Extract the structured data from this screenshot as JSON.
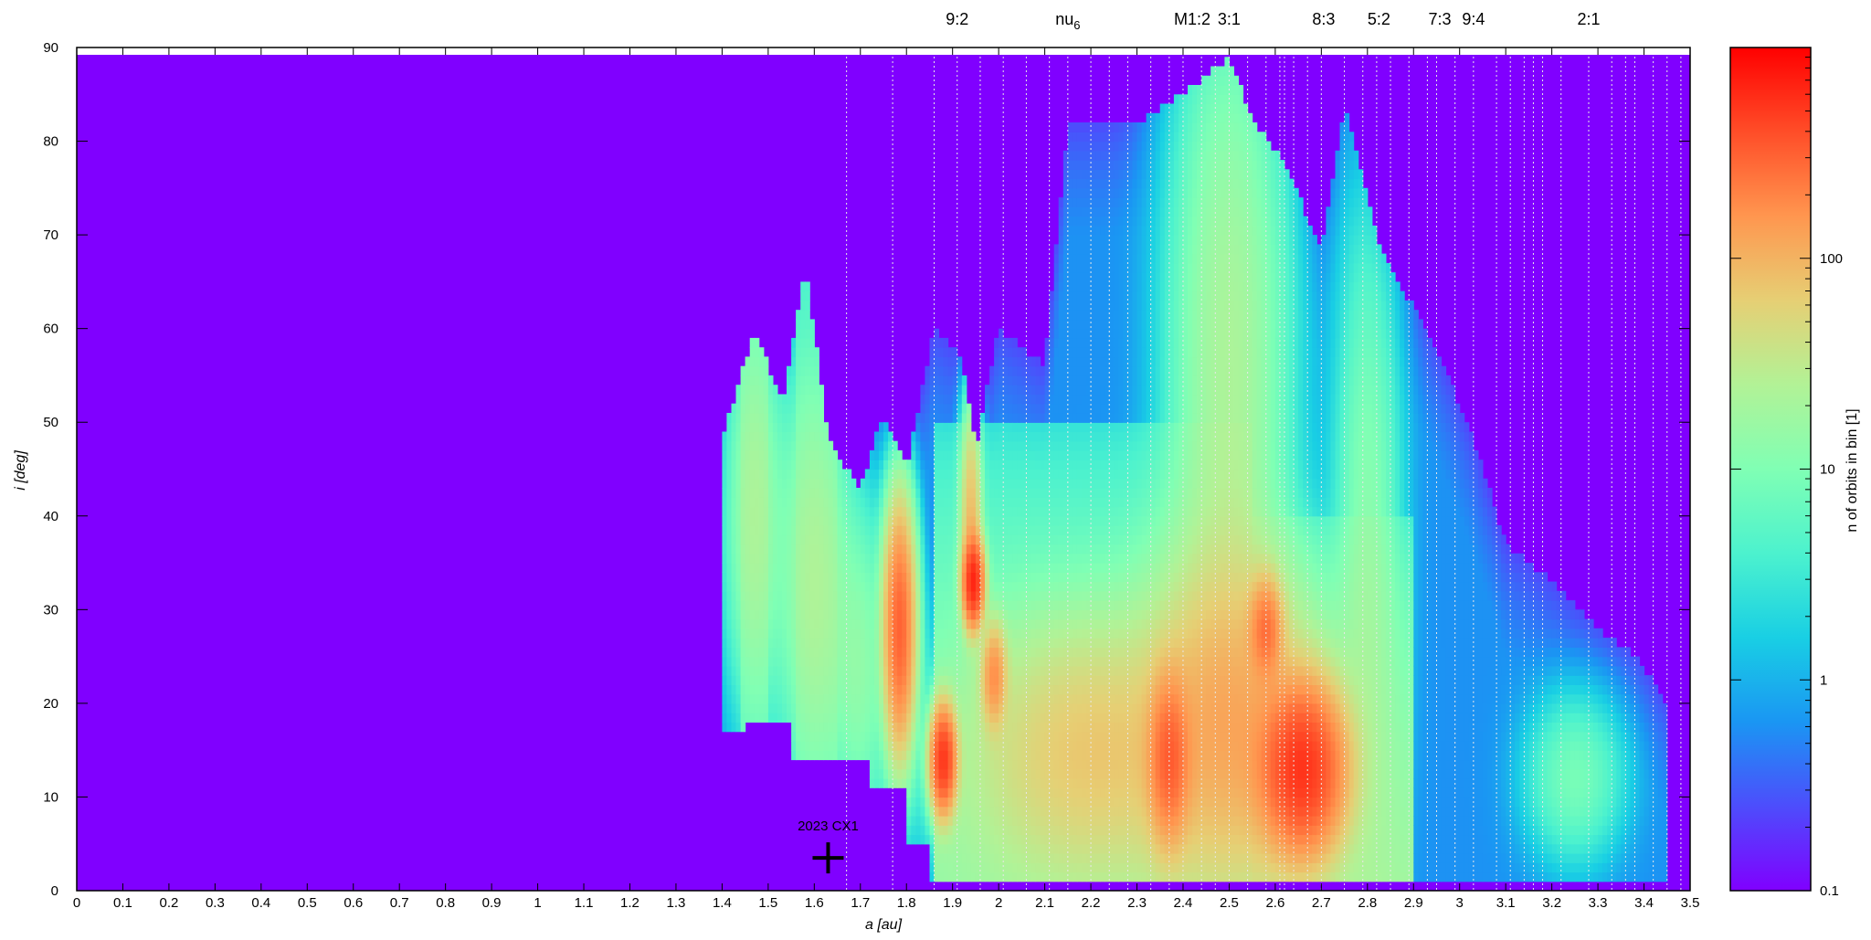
{
  "chart_data": {
    "type": "heatmap",
    "xlabel": "a [au]",
    "ylabel": "i [deg]",
    "xlim": [
      0,
      3.5
    ],
    "ylim": [
      0,
      90
    ],
    "xticks": [
      "0",
      "0.1",
      "0.2",
      "0.3",
      "0.4",
      "0.5",
      "0.6",
      "0.7",
      "0.8",
      "0.9",
      "1",
      "1.1",
      "1.2",
      "1.3",
      "1.4",
      "1.5",
      "1.6",
      "1.7",
      "1.8",
      "1.9",
      "2",
      "2.1",
      "2.2",
      "2.3",
      "2.4",
      "2.5",
      "2.6",
      "2.7",
      "2.8",
      "2.9",
      "3",
      "3.1",
      "3.2",
      "3.3",
      "3.4",
      "3.5"
    ],
    "yticks": [
      "0",
      "10",
      "20",
      "30",
      "40",
      "50",
      "60",
      "70",
      "80",
      "90"
    ],
    "colorbar": {
      "label": "n of orbits in bin [1]",
      "scale": "log",
      "range": [
        0.1,
        1000
      ],
      "ticks": [
        "0.1",
        "1",
        "10",
        "100"
      ]
    },
    "background_color": "#8000ff",
    "resonances": [
      {
        "label": "9:2",
        "a": 1.91
      },
      {
        "label": "nu6",
        "a": 2.15
      },
      {
        "label": "M1:2",
        "a": 2.42
      },
      {
        "label": "3:1",
        "a": 2.5
      },
      {
        "label": "8:3",
        "a": 2.705
      },
      {
        "label": "5:2",
        "a": 2.825
      },
      {
        "label": "7:3",
        "a": 2.957
      },
      {
        "label": "9:4",
        "a": 3.03
      },
      {
        "label": "2:1",
        "a": 3.28
      }
    ],
    "resonance_lines_a": [
      1.67,
      1.77,
      1.86,
      1.91,
      1.96,
      2.01,
      2.06,
      2.11,
      2.15,
      2.2,
      2.24,
      2.28,
      2.33,
      2.37,
      2.4,
      2.44,
      2.47,
      2.5,
      2.54,
      2.58,
      2.61,
      2.62,
      2.64,
      2.67,
      2.7,
      2.75,
      2.79,
      2.82,
      2.85,
      2.89,
      2.93,
      2.95,
      2.99,
      3.03,
      3.08,
      3.11,
      3.14,
      3.16,
      3.18,
      3.22,
      3.28,
      3.33,
      3.36,
      3.38,
      3.42,
      3.45,
      3.48
    ],
    "marker": {
      "label": "2023 CX1",
      "a": 1.63,
      "i": 3.5
    },
    "density_features": [
      {
        "a": 1.47,
        "i": 40,
        "sa": 0.035,
        "si": 12,
        "value": 18
      },
      {
        "a": 1.6,
        "i": 33,
        "sa": 0.045,
        "si": 13,
        "value": 20
      },
      {
        "a": 1.7,
        "i": 24,
        "sa": 0.035,
        "si": 10,
        "value": 12
      },
      {
        "a": 1.785,
        "i": 28,
        "sa": 0.018,
        "si": 7,
        "value": 300
      },
      {
        "a": 1.88,
        "i": 14,
        "sa": 0.015,
        "si": 3,
        "value": 500
      },
      {
        "a": 1.945,
        "i": 33,
        "sa": 0.012,
        "si": 2.5,
        "value": 600
      },
      {
        "a": 1.94,
        "i": 40,
        "sa": 0.012,
        "si": 6,
        "value": 80
      },
      {
        "a": 1.99,
        "i": 23,
        "sa": 0.015,
        "si": 3,
        "value": 150
      },
      {
        "a": 2.2,
        "i": 15,
        "sa": 0.15,
        "si": 8,
        "value": 60
      },
      {
        "a": 2.37,
        "i": 14,
        "sa": 0.025,
        "si": 5,
        "value": 250
      },
      {
        "a": 2.5,
        "i": 18,
        "sa": 0.1,
        "si": 10,
        "value": 100
      },
      {
        "a": 2.5,
        "i": 55,
        "sa": 0.07,
        "si": 22,
        "value": 22
      },
      {
        "a": 2.58,
        "i": 28,
        "sa": 0.02,
        "si": 3,
        "value": 200
      },
      {
        "a": 2.66,
        "i": 13,
        "sa": 0.05,
        "si": 5,
        "value": 500
      },
      {
        "a": 2.8,
        "i": 35,
        "sa": 0.04,
        "si": 20,
        "value": 12
      },
      {
        "a": 3.25,
        "i": 12,
        "sa": 0.06,
        "si": 5,
        "value": 8
      }
    ]
  }
}
